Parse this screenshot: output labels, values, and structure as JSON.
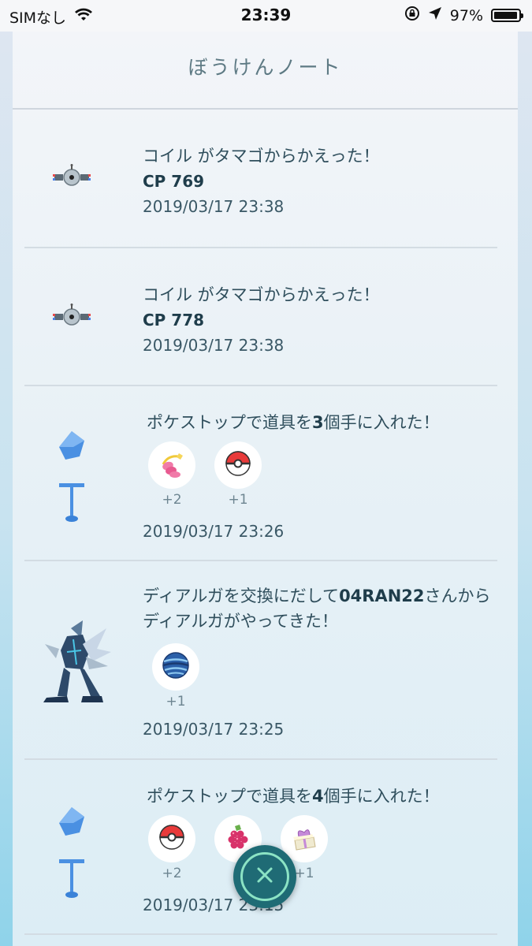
{
  "status_bar": {
    "carrier": "SIMなし",
    "time": "23:39",
    "battery_percent": "97%",
    "battery_level": 0.97,
    "icons": [
      "wifi-icon",
      "orientation-lock-icon",
      "location-arrow-icon",
      "battery-icon"
    ]
  },
  "page": {
    "title": "ぼうけんノート"
  },
  "entries": [
    {
      "icon": "magnemite-icon",
      "title": "コイル がタマゴからかえった！",
      "cp": "CP 769",
      "date": "2019/03/17 23:38"
    },
    {
      "icon": "magnemite-icon",
      "title": "コイル がタマゴからかえった！",
      "cp": "CP 778",
      "date": "2019/03/17 23:38"
    },
    {
      "icon": "pokestop-icon",
      "title_pre": "ポケストップで道具を",
      "title_num": "3",
      "title_post": "個手に入れた！",
      "items": [
        {
          "icon": "pinap-berry-icon",
          "count": "+2"
        },
        {
          "icon": "poke-ball-icon",
          "count": "+1"
        }
      ],
      "date": "2019/03/17 23:26"
    },
    {
      "icon": "dialga-icon",
      "title_pre": "ディアルガを交換にだして",
      "title_name": "04RAN22",
      "title_post": "さんからディアルガがやってきた！",
      "items": [
        {
          "icon": "dive-ball-icon",
          "count": "+1"
        }
      ],
      "date": "2019/03/17 23:25"
    },
    {
      "icon": "pokestop-icon",
      "title_pre": "ポケストップで道具を",
      "title_num": "4",
      "title_post": "個手に入れた！",
      "items": [
        {
          "icon": "poke-ball-icon",
          "count": "+2"
        },
        {
          "icon": "razz-berry-icon",
          "count": ""
        },
        {
          "icon": "gift-icon",
          "count": "+1"
        }
      ],
      "date": "2019/03/17 23:15"
    }
  ],
  "close_button": {
    "icon": "close-icon"
  },
  "colors": {
    "accent_close": "#1f6b75",
    "close_ring": "#8be3c4",
    "text_primary": "#2f4e5c",
    "pokestop_blue": "#4a90e2"
  }
}
